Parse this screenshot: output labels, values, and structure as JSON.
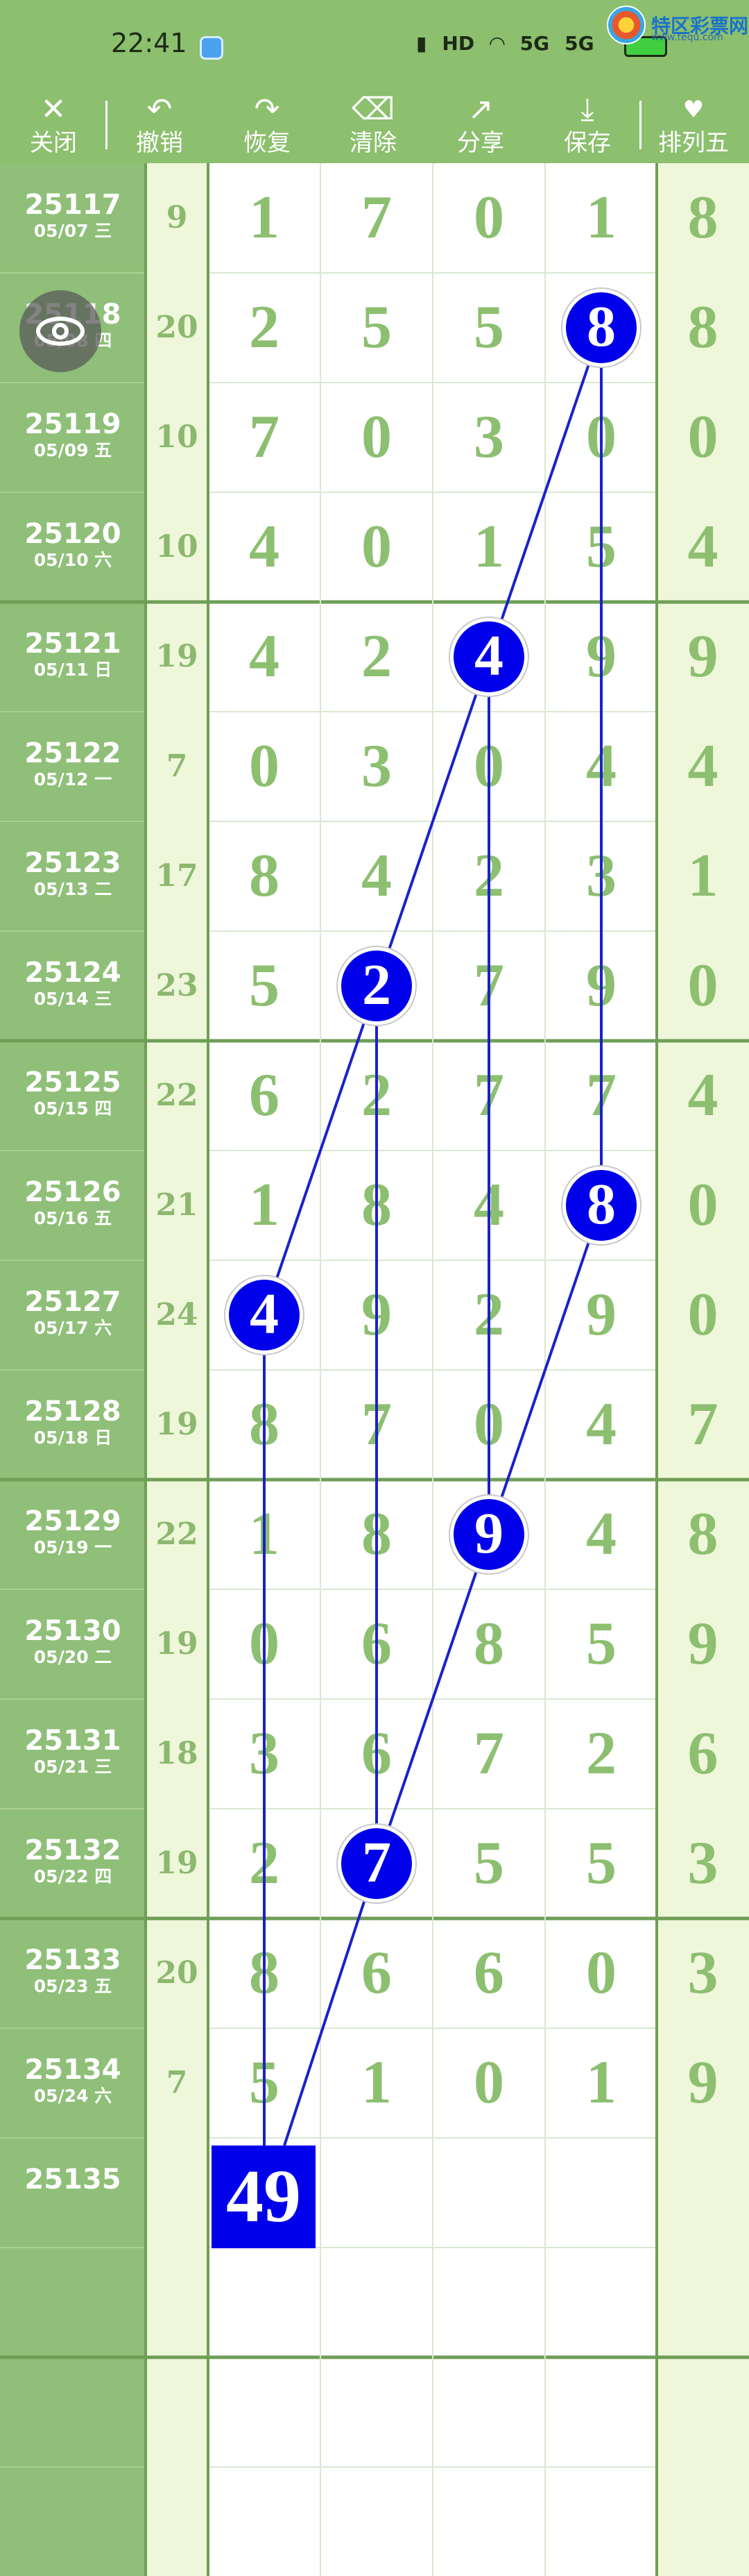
{
  "status_bar": {
    "time": "22:41",
    "icons": [
      "nfc-icon",
      "hd-icon",
      "wifi-icon",
      "signal-5g-icon",
      "signal-5g-icon",
      "battery-icon"
    ],
    "hd_label": "HD",
    "sig1_label": "5G",
    "sig2_label": "5G"
  },
  "brand": {
    "name": "特区彩票网",
    "url": "www.tequ.com"
  },
  "toolbar": {
    "items": [
      {
        "label": "关闭",
        "icon": "close-icon"
      },
      {
        "label": "撤销",
        "icon": "undo-icon"
      },
      {
        "label": "恢复",
        "icon": "redo-icon"
      },
      {
        "label": "清除",
        "icon": "trash-icon"
      },
      {
        "label": "分享",
        "icon": "share-icon"
      },
      {
        "label": "保存",
        "icon": "download-icon"
      },
      {
        "label": "排列五",
        "icon": "heart-icon"
      }
    ]
  },
  "rows": [
    {
      "issue": "25117",
      "date": "05/07 三",
      "sum": "9",
      "digits": [
        "1",
        "7",
        "0",
        "1"
      ],
      "p5": "8"
    },
    {
      "issue": "25118",
      "date": "05/08 四",
      "sum": "20",
      "digits": [
        "2",
        "5",
        "5",
        "8"
      ],
      "p5": "8"
    },
    {
      "issue": "25119",
      "date": "05/09 五",
      "sum": "10",
      "digits": [
        "7",
        "0",
        "3",
        "0"
      ],
      "p5": "0"
    },
    {
      "issue": "25120",
      "date": "05/10 六",
      "sum": "10",
      "digits": [
        "4",
        "0",
        "1",
        "5"
      ],
      "p5": "4"
    },
    {
      "issue": "25121",
      "date": "05/11 日",
      "sum": "19",
      "digits": [
        "4",
        "2",
        "4",
        "9"
      ],
      "p5": "9"
    },
    {
      "issue": "25122",
      "date": "05/12 一",
      "sum": "7",
      "digits": [
        "0",
        "3",
        "0",
        "4"
      ],
      "p5": "4"
    },
    {
      "issue": "25123",
      "date": "05/13 二",
      "sum": "17",
      "digits": [
        "8",
        "4",
        "2",
        "3"
      ],
      "p5": "1"
    },
    {
      "issue": "25124",
      "date": "05/14 三",
      "sum": "23",
      "digits": [
        "5",
        "2",
        "7",
        "9"
      ],
      "p5": "0"
    },
    {
      "issue": "25125",
      "date": "05/15 四",
      "sum": "22",
      "digits": [
        "6",
        "2",
        "7",
        "7"
      ],
      "p5": "4"
    },
    {
      "issue": "25126",
      "date": "05/16 五",
      "sum": "21",
      "digits": [
        "1",
        "8",
        "4",
        "8"
      ],
      "p5": "0"
    },
    {
      "issue": "25127",
      "date": "05/17 六",
      "sum": "24",
      "digits": [
        "4",
        "9",
        "2",
        "9"
      ],
      "p5": "0"
    },
    {
      "issue": "25128",
      "date": "05/18 日",
      "sum": "19",
      "digits": [
        "8",
        "7",
        "0",
        "4"
      ],
      "p5": "7"
    },
    {
      "issue": "25129",
      "date": "05/19 一",
      "sum": "22",
      "digits": [
        "1",
        "8",
        "9",
        "4"
      ],
      "p5": "8"
    },
    {
      "issue": "25130",
      "date": "05/20 二",
      "sum": "19",
      "digits": [
        "0",
        "6",
        "8",
        "5"
      ],
      "p5": "9"
    },
    {
      "issue": "25131",
      "date": "05/21 三",
      "sum": "18",
      "digits": [
        "3",
        "6",
        "7",
        "2"
      ],
      "p5": "6"
    },
    {
      "issue": "25132",
      "date": "05/22 四",
      "sum": "19",
      "digits": [
        "2",
        "7",
        "5",
        "5"
      ],
      "p5": "3"
    },
    {
      "issue": "25133",
      "date": "05/23 五",
      "sum": "20",
      "digits": [
        "8",
        "6",
        "6",
        "0"
      ],
      "p5": "3"
    },
    {
      "issue": "25134",
      "date": "05/24 六",
      "sum": "7",
      "digits": [
        "5",
        "1",
        "0",
        "1"
      ],
      "p5": "9"
    },
    {
      "issue": "25135",
      "date": "",
      "sum": "",
      "digits": [
        "",
        "",
        "",
        ""
      ],
      "p5": ""
    }
  ],
  "highlights": [
    {
      "row": 1,
      "col": 3,
      "value": "8"
    },
    {
      "row": 4,
      "col": 2,
      "value": "4"
    },
    {
      "row": 7,
      "col": 1,
      "value": "2"
    },
    {
      "row": 9,
      "col": 3,
      "value": "8"
    },
    {
      "row": 10,
      "col": 0,
      "value": "4"
    },
    {
      "row": 12,
      "col": 2,
      "value": "9"
    },
    {
      "row": 15,
      "col": 1,
      "value": "7"
    }
  ],
  "prediction": {
    "value": "49"
  },
  "colors": {
    "header_green": "#8cbf6e",
    "issue_col": "#8fbf78",
    "pale_col": "#eff7da",
    "digit_green": "#8cbf70",
    "highlight_blue": "#0000ea",
    "line_blue": "#1a22c8",
    "grid_line": "#d9e8cf",
    "group_line": "#6f9e57"
  }
}
